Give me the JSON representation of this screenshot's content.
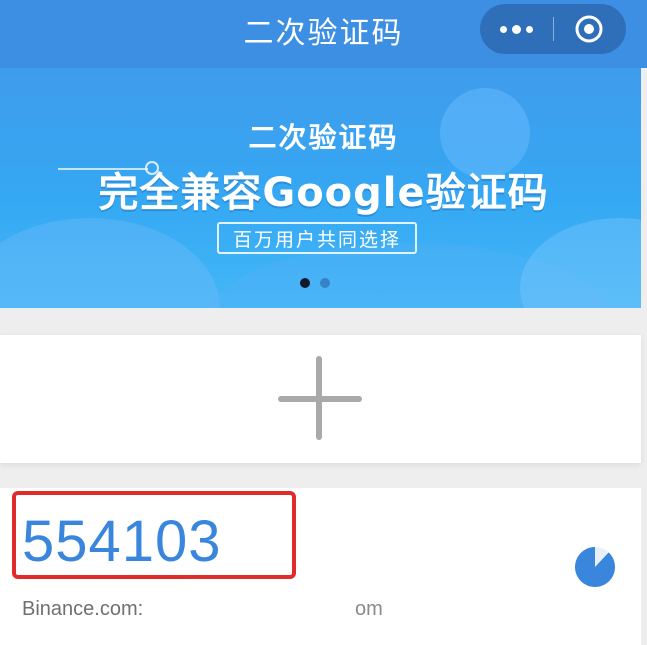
{
  "header": {
    "title": "二次验证码",
    "capsule_more_icon": "more-dots-icon",
    "capsule_close_icon": "target-icon"
  },
  "banner": {
    "subtitle": "二次验证码",
    "headline": "完全兼容Google验证码",
    "tag": "百万用户共同选择",
    "slide_count": 2,
    "active_slide": 1
  },
  "add_card": {
    "icon": "plus-icon"
  },
  "code_entry": {
    "code": "554103",
    "account_prefix": "Binance.com:",
    "account_suffix": "om",
    "timer_icon": "countdown-pie-icon",
    "timer_remaining_fraction": 0.88,
    "code_color": "#3a86dd",
    "highlight_color": "#e12b2b"
  },
  "colors": {
    "header_bg": "#3d8fe3",
    "banner_bg": "#3f9cec",
    "timer": "#3a86dd"
  }
}
